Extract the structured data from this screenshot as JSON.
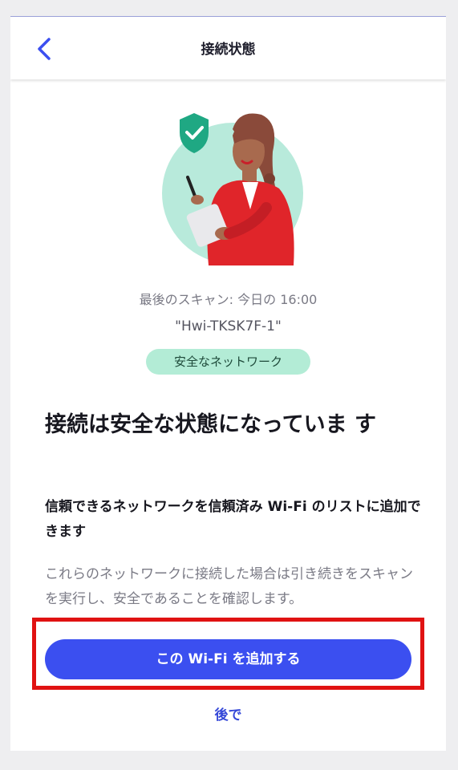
{
  "header": {
    "title": "接続状態",
    "back_icon": "chevron-left-icon"
  },
  "status": {
    "last_scan": "最後のスキャン: 今日の 16:00",
    "ssid": "\"Hwi-TKSK7F-1\"",
    "badge": "安全なネットワーク"
  },
  "content": {
    "headline": "接続は安全な状態になっていま す",
    "subhead": "信頼できるネットワークを信頼済み Wi-Fi のリストに追加できます",
    "body": "これらのネットワークに接続した場合は引き続きをスキャンを実行し、安全であることを確認します。"
  },
  "actions": {
    "add_wifi": "この Wi-Fi を追加する",
    "later": "後で"
  },
  "colors": {
    "accent": "#3b4ff0",
    "badge_bg": "#b3ecd6",
    "highlight": "#e01212",
    "shield": "#1fa883"
  }
}
